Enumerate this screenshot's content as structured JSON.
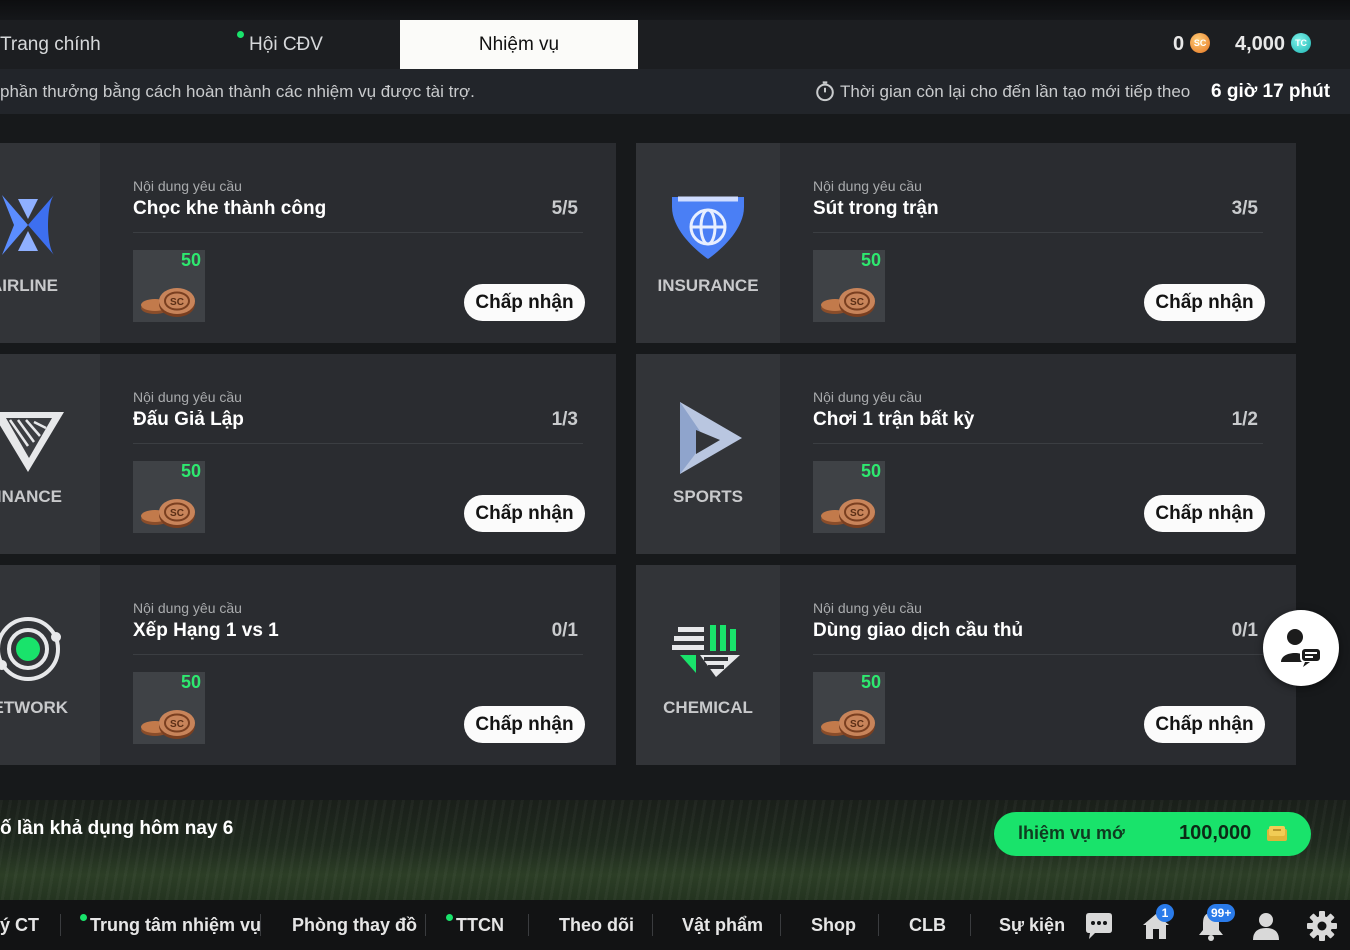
{
  "tabs": [
    {
      "label": "Trang chính",
      "dot": false
    },
    {
      "label": "Hội CĐV",
      "dot": true
    },
    {
      "label": "Nhiệm vụ",
      "active": true
    }
  ],
  "currency": {
    "sc": "0",
    "sc_icon": "SC",
    "tc": "4,000",
    "tc_icon": "TC"
  },
  "info": {
    "description": "phần thưởng bằng cách hoàn thành các nhiệm vụ được tài trợ.",
    "timer_label": "Thời gian còn lại cho đến lần tạo mới tiếp theo",
    "timer_value": "6 giờ 17 phút"
  },
  "missions": [
    {
      "sponsor": "AIRLINE",
      "label": "Nội dung yêu cầu",
      "title": "Chọc khe thành công",
      "progress": "5/5",
      "reward": "50",
      "accept": "Chấp nhận"
    },
    {
      "sponsor": "INSURANCE",
      "label": "Nội dung yêu cầu",
      "title": "Sút trong trận",
      "progress": "3/5",
      "reward": "50",
      "accept": "Chấp nhận"
    },
    {
      "sponsor": "INANCE",
      "label": "Nội dung yêu cầu",
      "title": "Đấu Giả Lập",
      "progress": "1/3",
      "reward": "50",
      "accept": "Chấp nhận"
    },
    {
      "sponsor": "SPORTS",
      "label": "Nội dung yêu cầu",
      "title": "Chơi 1 trận bất kỳ",
      "progress": "1/2",
      "reward": "50",
      "accept": "Chấp nhận"
    },
    {
      "sponsor": "ETWORK",
      "label": "Nội dung yêu cầu",
      "title": "Xếp Hạng 1 vs 1",
      "progress": "0/1",
      "reward": "50",
      "accept": "Chấp nhận"
    },
    {
      "sponsor": "CHEMICAL",
      "label": "Nội dung yêu cầu",
      "title": "Dùng giao dịch cầu thủ",
      "progress": "0/1",
      "reward": "50",
      "accept": "Chấp nhận"
    }
  ],
  "footer": {
    "daily_text": "ố lần khả dụng hôm nay 6",
    "new_mission_label": "lhiệm vụ mớ",
    "new_mission_cost": "100,000"
  },
  "bottom_nav": {
    "items": [
      {
        "label": "ý CT",
        "dot": false
      },
      {
        "label": "Trung tâm nhiệm vụ",
        "dot": true
      },
      {
        "label": "Phòng thay đồ",
        "dot": false
      },
      {
        "label": "TTCN",
        "dot": true
      },
      {
        "label": "Theo dõi",
        "dot": false
      },
      {
        "label": "Vật phẩm",
        "dot": false
      },
      {
        "label": "Shop",
        "dot": false
      },
      {
        "label": "CLB",
        "dot": false
      },
      {
        "label": "Sự kiện",
        "dot": false
      }
    ],
    "icons": [
      {
        "name": "chat-icon"
      },
      {
        "name": "home-icon",
        "badge": "1"
      },
      {
        "name": "bell-icon",
        "badge": "99+"
      },
      {
        "name": "profile-icon"
      },
      {
        "name": "gear-icon"
      }
    ]
  },
  "colors": {
    "accent_green": "#19e36b",
    "card_bg": "#2a2c30",
    "logo_panel_bg": "#323438"
  }
}
